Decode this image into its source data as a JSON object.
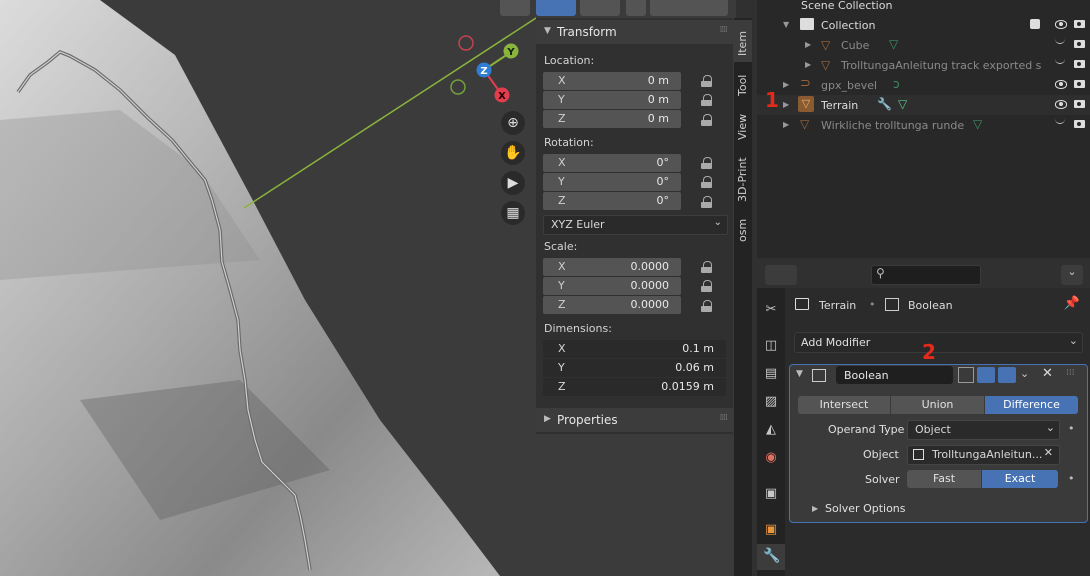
{
  "viewport": {
    "gizmo": {
      "y": "Y",
      "z": "Z",
      "x": "X"
    },
    "nav_icons": [
      "zoom-icon",
      "hand-pan-icon",
      "camera-icon",
      "grid-icon"
    ]
  },
  "npanel": {
    "transform_title": "Transform",
    "location_label": "Location:",
    "location": [
      {
        "k": "X",
        "v": "0 m"
      },
      {
        "k": "Y",
        "v": "0 m"
      },
      {
        "k": "Z",
        "v": "0 m"
      }
    ],
    "rotation_label": "Rotation:",
    "rotation": [
      {
        "k": "X",
        "v": "0°"
      },
      {
        "k": "Y",
        "v": "0°"
      },
      {
        "k": "Z",
        "v": "0°"
      }
    ],
    "rotation_mode": "XYZ Euler",
    "scale_label": "Scale:",
    "scale": [
      {
        "k": "X",
        "v": "0.0000"
      },
      {
        "k": "Y",
        "v": "0.0000"
      },
      {
        "k": "Z",
        "v": "0.0000"
      }
    ],
    "dimensions_label": "Dimensions:",
    "dimensions": [
      {
        "k": "X",
        "v": "0.1 m"
      },
      {
        "k": "Y",
        "v": "0.06 m"
      },
      {
        "k": "Z",
        "v": "0.0159 m"
      }
    ],
    "properties_title": "Properties"
  },
  "tabs": [
    "Item",
    "Tool",
    "View",
    "3D-Print",
    "osm"
  ],
  "outliner": {
    "scene_collection": "Scene Collection",
    "collection": "Collection",
    "cube": "Cube",
    "track": "TrolltungaAnleitung track exported s",
    "gpx_bevel": "gpx_bevel",
    "terrain": "Terrain",
    "wirkliche": "Wirkliche trolltunga runde",
    "annotation_1": "1"
  },
  "properties": {
    "breadcrumb_object": "Terrain",
    "breadcrumb_modifier": "Boolean",
    "add_modifier": "Add Modifier",
    "annotation_2": "2",
    "modifier_name": "Boolean",
    "operations": [
      "Intersect",
      "Union",
      "Difference"
    ],
    "operation_active": "Difference",
    "operand_type_label": "Operand Type",
    "operand_type_value": "Object",
    "object_label": "Object",
    "object_value": "TrolltungaAnleitun...",
    "solver_label": "Solver",
    "solvers": [
      "Fast",
      "Exact"
    ],
    "solver_active": "Exact",
    "solver_options": "Solver Options"
  },
  "colors": {
    "accent": "#4772b3",
    "annotation": "#e52a1a",
    "object_orange": "#e8953c",
    "mesh_green": "#5dc68c"
  }
}
